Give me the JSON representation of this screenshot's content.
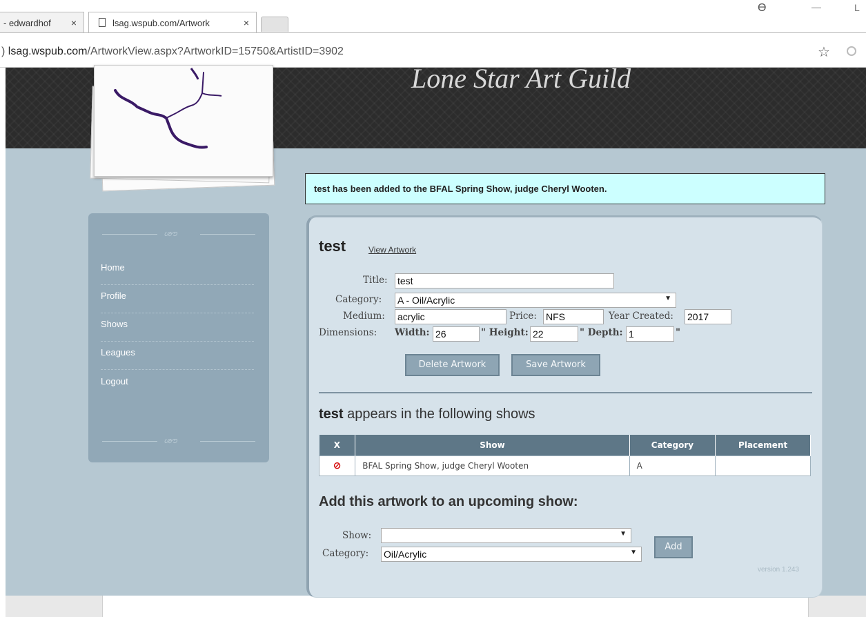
{
  "browser": {
    "tabs": [
      {
        "label": "edwardhof",
        "prefix": "-"
      },
      {
        "label": "lsag.wspub.com/Artwork"
      }
    ],
    "close_glyph": "×",
    "url": {
      "prefix": ") ",
      "host": "lsag.wspub.com",
      "path": "/ArtworkView.aspx?ArtworkID=15750&ArtistID=3902"
    },
    "window_controls": {
      "user": "ϴ",
      "minimize": "—",
      "maximize": "L"
    },
    "star": "☆"
  },
  "site": {
    "title": "Lone Star Art Guild"
  },
  "sidebar": {
    "ornament": "ശൗ",
    "items": [
      {
        "label": "Home"
      },
      {
        "label": "Profile"
      },
      {
        "label": "Shows"
      },
      {
        "label": "Leagues"
      },
      {
        "label": "Logout"
      }
    ]
  },
  "notice": "test has been added to the BFAL Spring Show, judge Cheryl Wooten.",
  "artwork": {
    "title": "test",
    "view_link": "View Artwork",
    "labels": {
      "title": "Title:",
      "category": "Category:",
      "medium": "Medium:",
      "price": "Price:",
      "year": "Year Created:",
      "dimensions": "Dimensions:",
      "width": "Width:",
      "height": "\" Height:",
      "depth": "\" Depth:",
      "inch": "\""
    },
    "values": {
      "title": "test",
      "category": "A - Oil/Acrylic",
      "medium": "acrylic",
      "price": "NFS",
      "year": "2017",
      "width": "26",
      "height": "22",
      "depth": "1"
    },
    "buttons": {
      "delete": "Delete Artwork",
      "save": "Save Artwork"
    }
  },
  "shows": {
    "heading_bold": "test",
    "heading_rest": " appears in the following shows",
    "columns": [
      "X",
      "Show",
      "Category",
      "Placement"
    ],
    "rows": [
      {
        "x": "⊘",
        "show": "BFAL Spring Show, judge Cheryl Wooten",
        "category": "A",
        "placement": ""
      }
    ]
  },
  "add_show": {
    "heading": "Add this artwork to an upcoming show:",
    "show_label": "Show:",
    "show_value": "",
    "category_label": "Category:",
    "category_value": "Oil/Acrylic",
    "button": "Add"
  },
  "dropdown_arrow": "▼",
  "version": "version 1.243",
  "colors": {
    "header_bg": "#2c2c2c",
    "content_bg": "#b6c8d2",
    "sidebar_bg": "#91a8b7",
    "panel_bg": "#d6e2ea",
    "notice_bg": "#ccffff",
    "table_header": "#5e7787",
    "button_bg": "#8ea5b4",
    "logo_stroke": "#3a1a66"
  }
}
